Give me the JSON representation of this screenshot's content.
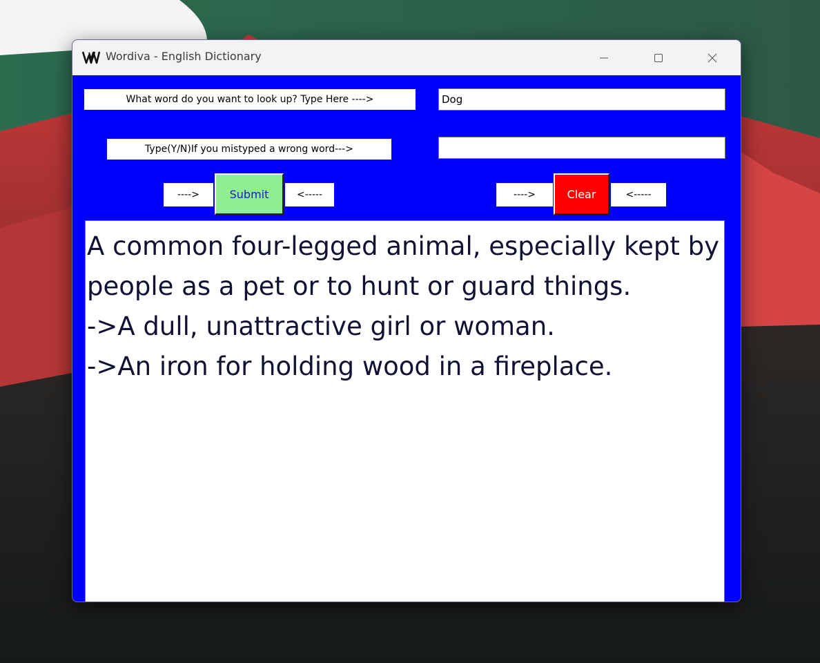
{
  "window": {
    "title": "Wordiva - English Dictionary",
    "controls": {
      "minimize_icon": "minimize-icon",
      "maximize_icon": "maximize-icon",
      "close_icon": "close-icon"
    }
  },
  "form": {
    "word_prompt": "What word do you want to look up? Type Here ---->",
    "word_value": "Dog",
    "confirm_prompt": "Type(Y/N)If you mistyped a wrong word--->",
    "confirm_value": "",
    "submit_left_arrow": "---->",
    "submit_label": "Submit",
    "submit_right_arrow": "<-----",
    "clear_left_arrow": "---->",
    "clear_label": "Clear",
    "clear_right_arrow": "<-----"
  },
  "output": {
    "lines": [
      "A common four-legged animal, especially kept by people as a pet or to hunt or guard things.",
      "->A dull, unattractive girl or woman.",
      "->An iron for holding wood in a fireplace."
    ]
  },
  "colors": {
    "background": "#0000ff",
    "submit_button": "#90ee90",
    "clear_button": "#ff0000"
  }
}
